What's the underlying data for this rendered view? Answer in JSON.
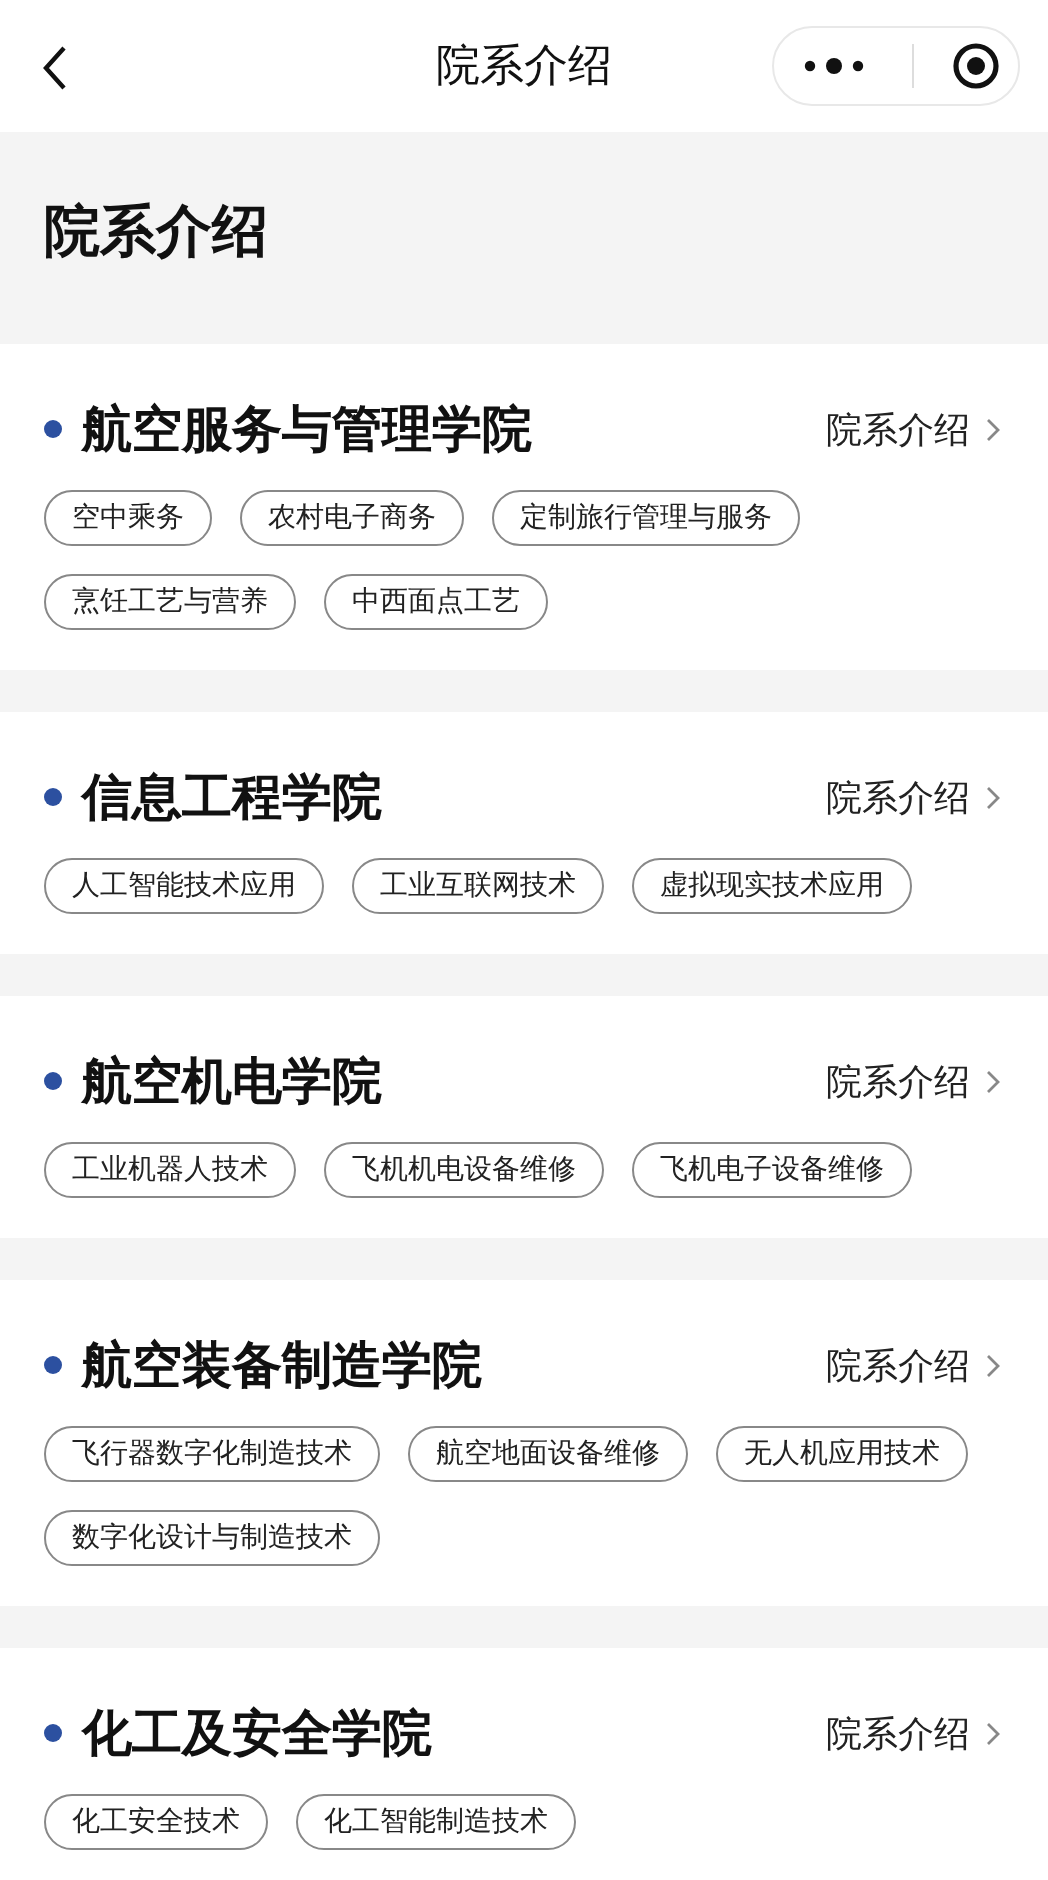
{
  "nav": {
    "title": "院系介绍"
  },
  "header": {
    "title": "院系介绍"
  },
  "departments": [
    {
      "name": "航空服务与管理学院",
      "link": "院系介绍",
      "majors": [
        "空中乘务",
        "农村电子商务",
        "定制旅行管理与服务",
        "烹饪工艺与营养",
        "中西面点工艺"
      ]
    },
    {
      "name": "信息工程学院",
      "link": "院系介绍",
      "majors": [
        "人工智能技术应用",
        "工业互联网技术",
        "虚拟现实技术应用"
      ]
    },
    {
      "name": "航空机电学院",
      "link": "院系介绍",
      "majors": [
        "工业机器人技术",
        "飞机机电设备维修",
        "飞机电子设备维修"
      ]
    },
    {
      "name": "航空装备制造学院",
      "link": "院系介绍",
      "majors": [
        "飞行器数字化制造技术",
        "航空地面设备维修",
        "无人机应用技术",
        "数字化设计与制造技术"
      ]
    },
    {
      "name": "化工及安全学院",
      "link": "院系介绍",
      "majors": [
        "化工安全技术",
        "化工智能制造技术"
      ]
    }
  ]
}
